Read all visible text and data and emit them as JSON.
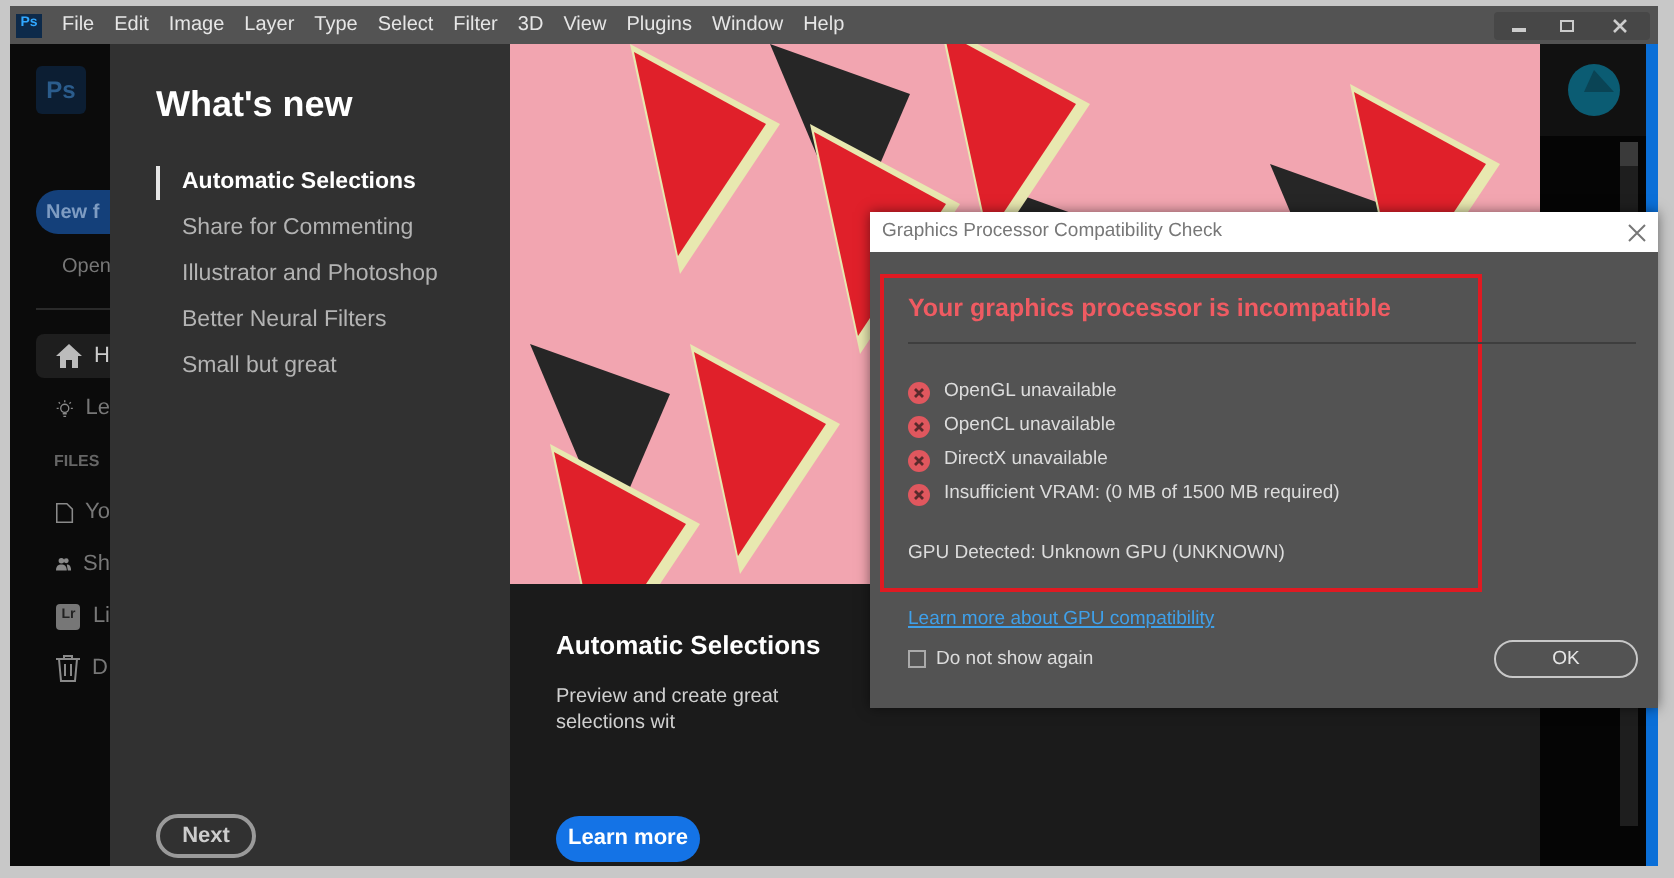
{
  "app_logo": "Ps",
  "menu": [
    "File",
    "Edit",
    "Image",
    "Layer",
    "Type",
    "Select",
    "Filter",
    "3D",
    "View",
    "Plugins",
    "Window",
    "Help"
  ],
  "sidebar": {
    "logo": "Ps",
    "new_button": "New f",
    "open": "Open",
    "files_header": "FILES",
    "items": [
      {
        "kind": "home",
        "label": "H",
        "selected": true
      },
      {
        "kind": "bulb",
        "label": "Le",
        "selected": false
      },
      {
        "kind": "file",
        "label": "Yo",
        "selected": false
      },
      {
        "kind": "people",
        "label": "Sh",
        "selected": false
      },
      {
        "kind": "lr",
        "badge": "Lr",
        "label": "Li",
        "selected": false
      },
      {
        "kind": "trash",
        "label": "D",
        "selected": false
      }
    ]
  },
  "whats_new": {
    "title": "What's new",
    "items": [
      {
        "label": "Automatic Selections",
        "selected": true
      },
      {
        "label": "Share for Commenting",
        "selected": false
      },
      {
        "label": "Illustrator and Photoshop",
        "selected": false
      },
      {
        "label": "Better Neural Filters",
        "selected": false
      },
      {
        "label": "Small but great",
        "selected": false
      }
    ],
    "next_button": "Next"
  },
  "feature": {
    "title": "Automatic Selections",
    "description": "Preview and create great selections wit",
    "button": "Learn more"
  },
  "dialog": {
    "title": "Graphics Processor Compatibility Check",
    "heading": "Your graphics processor is incompatible",
    "errors": [
      "OpenGL unavailable",
      "OpenCL unavailable",
      "DirectX unavailable",
      "Insufficient VRAM: (0 MB of 1500 MB required)"
    ],
    "gpu_detected": "GPU Detected: Unknown GPU (UNKNOWN)",
    "link": "Learn more about GPU compatibility",
    "checkbox": {
      "label": "Do not show again",
      "checked": false
    },
    "ok_button": "OK"
  }
}
